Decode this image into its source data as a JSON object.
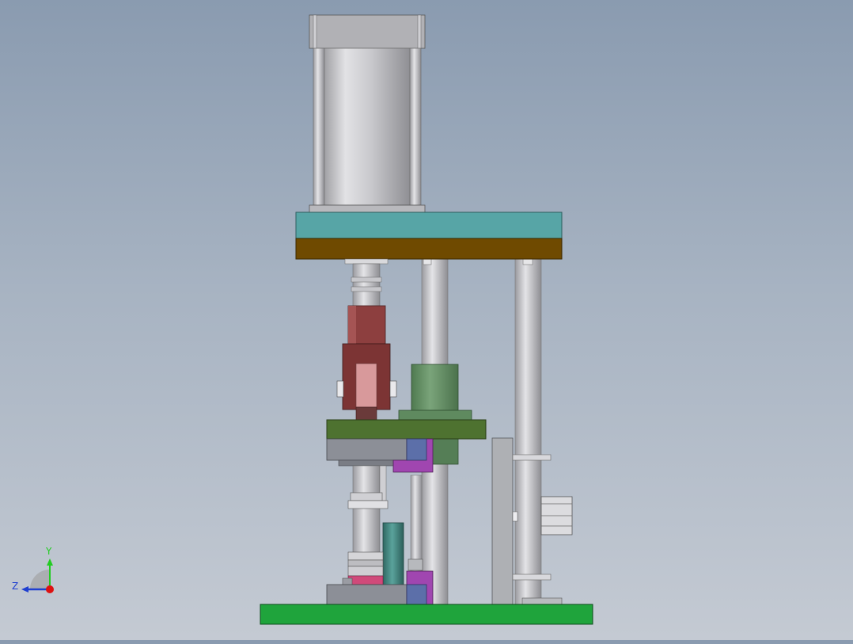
{
  "viewport": {
    "background_top": "#8a9bb0",
    "background_bottom": "#c4cad3"
  },
  "triad": {
    "y_label": "Y",
    "z_label": "Z",
    "y_color": "#22cc22",
    "z_color": "#1f3fd0",
    "origin_color": "#dd1111"
  },
  "colors": {
    "cylinder_body": "#c4c4c8",
    "cap": "#a9a9ad",
    "top_plate": "#57a5a6",
    "mid_plate": "#6f4a00",
    "guide_post": "#bdbdc2",
    "clevis": "#8a3a3a",
    "clevis_light": "#d8999b",
    "bushing": "#5f8a5f",
    "press_plate": "#4e7230",
    "slider": "#8c8f97",
    "blue_block": "#5c6fa9",
    "purple_block": "#a046b0",
    "teal_post": "#3f7f7a",
    "pink_ring": "#d04a7a",
    "bracket": "#aeb0b4",
    "base_plate": "#1fa43c"
  }
}
